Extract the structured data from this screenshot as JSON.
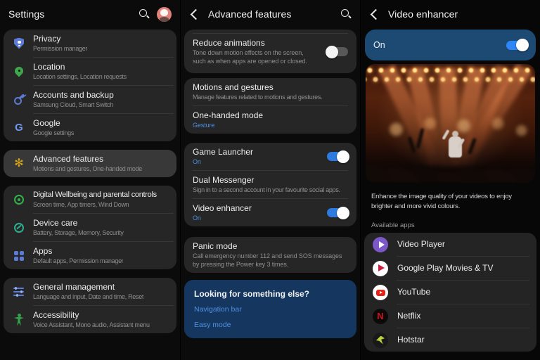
{
  "colors": {
    "background": "#0b0b0b",
    "card": "#262626",
    "selected_card": "#383838",
    "navy_footer_card": "#15375f",
    "navy_on_card": "#1d4a73",
    "title_text": "#ededed",
    "subtitle_text": "#8f8f8f",
    "link_blue": "#4f8fe3",
    "toggle_on_blue": "#2d7be0"
  },
  "settings": {
    "title": "Settings",
    "cards": [
      {
        "items": [
          {
            "icon": "privacy-shield-icon",
            "title": "Privacy",
            "subtitle": "Permission manager"
          },
          {
            "icon": "location-pin-icon",
            "title": "Location",
            "subtitle": "Location settings, Location requests"
          },
          {
            "icon": "key-icon",
            "title": "Accounts and backup",
            "subtitle": "Samsung Cloud, Smart Switch"
          },
          {
            "icon": "google-g-icon",
            "title": "Google",
            "subtitle": "Google settings"
          }
        ]
      },
      {
        "selected": true,
        "items": [
          {
            "icon": "advanced-features-gear-icon",
            "title": "Advanced features",
            "subtitle": "Motions and gestures, One-handed mode"
          }
        ]
      },
      {
        "items": [
          {
            "icon": "digital-wellbeing-icon",
            "title": "Digital Wellbeing and parental controls",
            "subtitle": "Screen time, App timers, Wind Down"
          },
          {
            "icon": "device-care-icon",
            "title": "Device care",
            "subtitle": "Battery, Storage, Memory, Security"
          },
          {
            "icon": "apps-grid-icon",
            "title": "Apps",
            "subtitle": "Default apps, Permission manager"
          }
        ]
      },
      {
        "items": [
          {
            "icon": "sliders-icon",
            "title": "General management",
            "subtitle": "Language and input, Date and time, Reset"
          },
          {
            "icon": "accessibility-person-icon",
            "title": "Accessibility",
            "subtitle": "Voice Assistant, Mono audio, Assistant menu"
          }
        ]
      }
    ]
  },
  "advanced": {
    "title": "Advanced features",
    "items": [
      {
        "title": "Reduce animations",
        "subtitle": "Tone down motion effects on the screen, such as when apps are opened or closed.",
        "state": "off"
      },
      {
        "title": "Motions and gestures",
        "subtitle": "Manage features related to motions and gestures."
      },
      {
        "title": "One-handed mode",
        "value": "Gesture"
      },
      {
        "title": "Game Launcher",
        "value": "On",
        "state": "on"
      },
      {
        "title": "Dual Messenger",
        "subtitle": "Sign in to a second account in your favourite social apps."
      },
      {
        "title": "Video enhancer",
        "value": "On",
        "state": "on"
      },
      {
        "title": "Panic mode",
        "subtitle": "Call emergency number 112 and send SOS messages by pressing the Power key 3 times."
      }
    ],
    "footer": {
      "title": "Looking for something else?",
      "links": [
        "Navigation bar",
        "Easy mode"
      ]
    }
  },
  "video": {
    "title": "Video enhancer",
    "master": {
      "label": "On",
      "state": "on"
    },
    "description": "Enhance the image quality of your videos to enjoy brighter and more vivid colours.",
    "section_label": "Available apps",
    "apps": [
      {
        "icon": "video-player-icon",
        "label": "Video Player"
      },
      {
        "icon": "google-play-movies-icon",
        "label": "Google Play Movies & TV"
      },
      {
        "icon": "youtube-icon",
        "label": "YouTube"
      },
      {
        "icon": "netflix-icon",
        "label": "Netflix"
      },
      {
        "icon": "hotstar-icon",
        "label": "Hotstar"
      }
    ],
    "netflix_glyph": "N",
    "google_glyph": "G",
    "advanced_gear_glyph": "✻"
  }
}
